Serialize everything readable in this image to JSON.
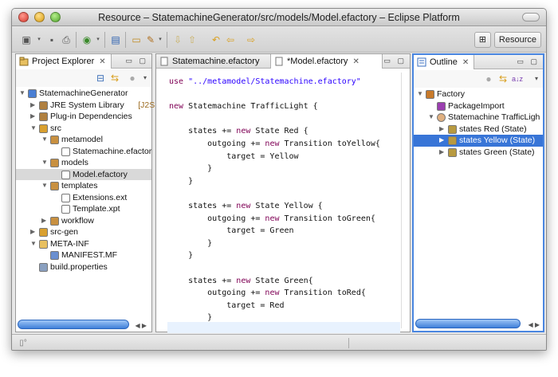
{
  "window": {
    "title": "Resource – StatemachineGenerator/src/models/Model.efactory – Eclipse Platform"
  },
  "toolbar": {
    "icons": [
      "new-wizard-icon",
      "save-icon",
      "print-icon",
      "run-icon",
      "new-folder-icon",
      "open-type-icon",
      "search-icon",
      "next-annotation-icon",
      "prev-annotation-icon",
      "back-icon",
      "forward-icon"
    ],
    "perspective_label": "Resource"
  },
  "project_explorer": {
    "tab_label": "Project Explorer",
    "tree": [
      {
        "label": "StatemachineGenerator",
        "depth": 0,
        "expanded": true,
        "icon": "project-icon"
      },
      {
        "label": "JRE System Library",
        "decoration": "[J2SE-1.",
        "depth": 1,
        "expanded": false,
        "icon": "library-icon"
      },
      {
        "label": "Plug-in Dependencies",
        "depth": 1,
        "expanded": false,
        "icon": "library-icon"
      },
      {
        "label": "src",
        "depth": 1,
        "expanded": true,
        "icon": "source-folder-icon"
      },
      {
        "label": "metamodel",
        "depth": 2,
        "expanded": true,
        "icon": "package-icon"
      },
      {
        "label": "Statemachine.efactor",
        "depth": 3,
        "icon": "file-icon"
      },
      {
        "label": "models",
        "depth": 2,
        "expanded": true,
        "icon": "package-icon"
      },
      {
        "label": "Model.efactory",
        "depth": 3,
        "icon": "file-icon",
        "selected": true
      },
      {
        "label": "templates",
        "depth": 2,
        "expanded": true,
        "icon": "package-icon"
      },
      {
        "label": "Extensions.ext",
        "depth": 3,
        "icon": "file-icon"
      },
      {
        "label": "Template.xpt",
        "depth": 3,
        "icon": "file-icon"
      },
      {
        "label": "workflow",
        "depth": 2,
        "expanded": false,
        "icon": "package-icon"
      },
      {
        "label": "src-gen",
        "depth": 1,
        "expanded": false,
        "icon": "source-folder-icon"
      },
      {
        "label": "META-INF",
        "depth": 1,
        "expanded": true,
        "icon": "folder-icon"
      },
      {
        "label": "MANIFEST.MF",
        "depth": 2,
        "icon": "manifest-icon"
      },
      {
        "label": "build.properties",
        "depth": 1,
        "icon": "properties-icon"
      }
    ]
  },
  "editor": {
    "tabs": [
      {
        "label": "Statemachine.efactory",
        "active": false
      },
      {
        "label": "*Model.efactory",
        "active": true
      }
    ],
    "lines": [
      [
        [
          "kw",
          "use"
        ],
        [
          "txt",
          " "
        ],
        [
          "str",
          "\"../metamodel/Statemachine.efactory\""
        ]
      ],
      [],
      [
        [
          "kw",
          "new"
        ],
        [
          "txt",
          " Statemachine TrafficLight {"
        ]
      ],
      [],
      [
        [
          "txt",
          "    states += "
        ],
        [
          "kw",
          "new"
        ],
        [
          "txt",
          " State Red {"
        ]
      ],
      [
        [
          "txt",
          "        outgoing += "
        ],
        [
          "kw",
          "new"
        ],
        [
          "txt",
          " Transition toYellow{"
        ]
      ],
      [
        [
          "txt",
          "            target = Yellow"
        ]
      ],
      [
        [
          "txt",
          "        }"
        ]
      ],
      [
        [
          "txt",
          "    }"
        ]
      ],
      [],
      [
        [
          "txt",
          "    states += "
        ],
        [
          "kw",
          "new"
        ],
        [
          "txt",
          " State Yellow {"
        ]
      ],
      [
        [
          "txt",
          "        outgoing += "
        ],
        [
          "kw",
          "new"
        ],
        [
          "txt",
          " Transition toGreen{"
        ]
      ],
      [
        [
          "txt",
          "            target = Green"
        ]
      ],
      [
        [
          "txt",
          "        }"
        ]
      ],
      [
        [
          "txt",
          "    }"
        ]
      ],
      [],
      [
        [
          "txt",
          "    states += "
        ],
        [
          "kw",
          "new"
        ],
        [
          "txt",
          " State Green{"
        ]
      ],
      [
        [
          "txt",
          "        outgoing += "
        ],
        [
          "kw",
          "new"
        ],
        [
          "txt",
          " Transition toRed{"
        ]
      ],
      [
        [
          "txt",
          "            target = Red"
        ]
      ],
      [
        [
          "txt",
          "        }"
        ]
      ],
      [],
      [
        [
          "txt",
          "    }"
        ]
      ],
      [
        [
          "txt",
          "}"
        ]
      ]
    ]
  },
  "outline": {
    "tab_label": "Outline",
    "tree": [
      {
        "label": "Factory",
        "depth": 0,
        "expanded": true,
        "icon": "factory-icon"
      },
      {
        "label": "PackageImport",
        "depth": 1,
        "icon": "package-import-icon"
      },
      {
        "label": "Statemachine TrafficLigh",
        "depth": 1,
        "expanded": true,
        "icon": "statemachine-icon"
      },
      {
        "label": "states Red (State)",
        "depth": 2,
        "expanded": false,
        "icon": "reference-icon"
      },
      {
        "label": "states Yellow (State)",
        "depth": 2,
        "expanded": false,
        "icon": "reference-icon",
        "selected": true
      },
      {
        "label": "states Green (State)",
        "depth": 2,
        "expanded": false,
        "icon": "reference-icon"
      }
    ]
  },
  "colors": {
    "keyword": "#7f0055",
    "string": "#2a00ff",
    "selection": "#3875d7"
  }
}
